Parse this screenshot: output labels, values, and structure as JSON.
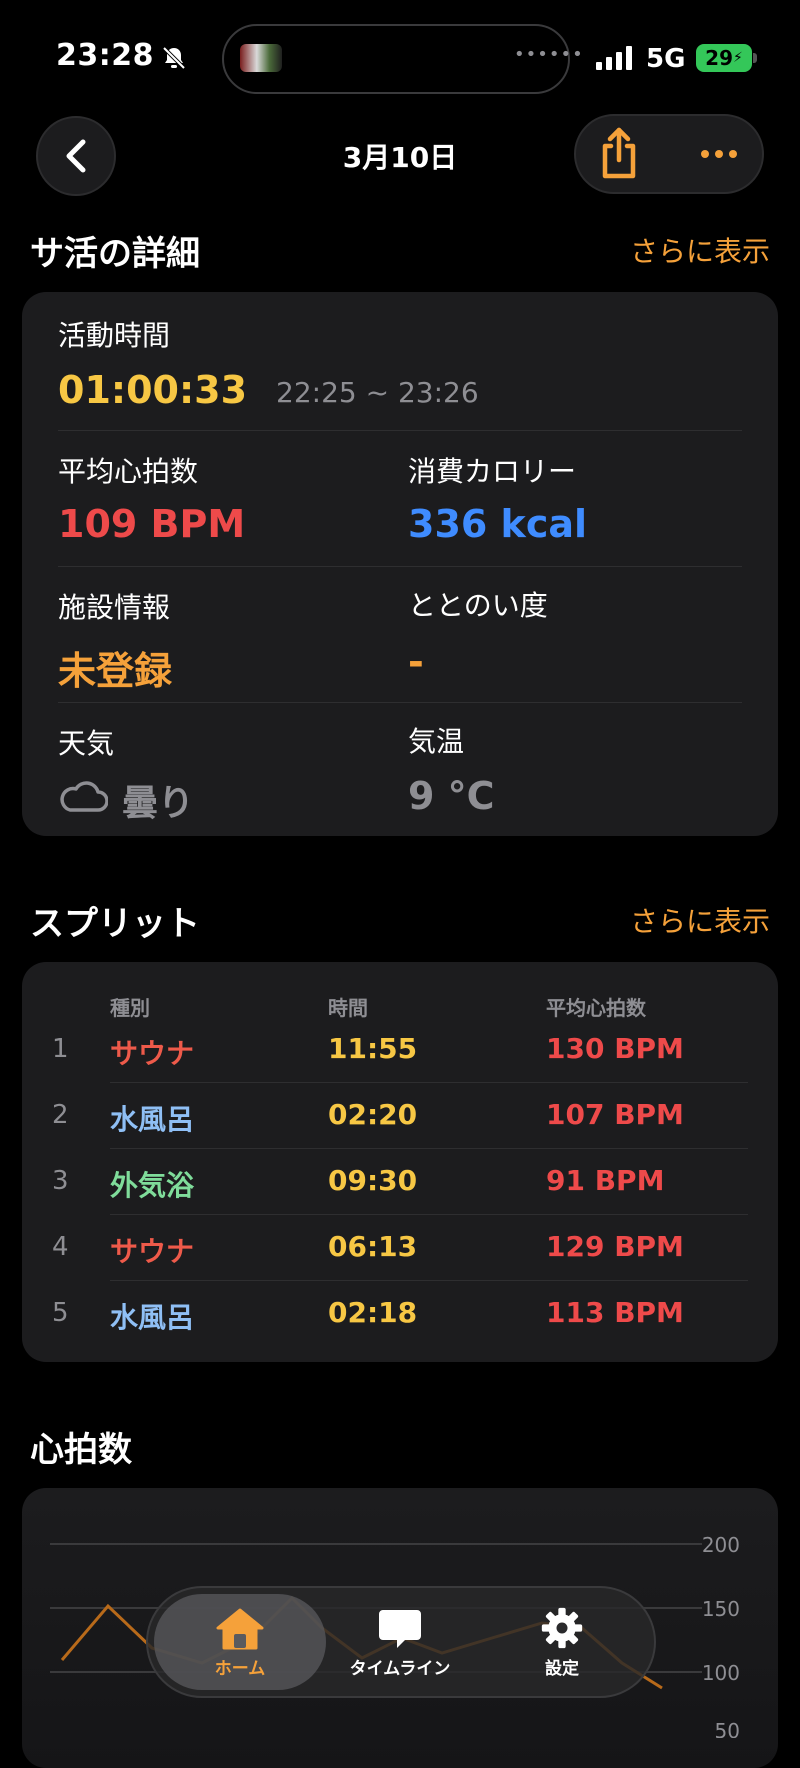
{
  "status_bar": {
    "time": "23:28",
    "network": "5G",
    "battery": "29"
  },
  "nav": {
    "title": "3月10日"
  },
  "summary": {
    "section_title": "サ活の詳細",
    "see_more": "さらに表示",
    "activity_time_label": "活動時間",
    "activity_time_value": "01:00:33",
    "activity_time_range": "22:25 ~ 23:26",
    "avg_hr_label": "平均心拍数",
    "avg_hr_value": "109 BPM",
    "calories_label": "消費カロリー",
    "calories_value": "336 kcal",
    "facility_label": "施設情報",
    "facility_value": "未登録",
    "totonoi_label": "ととのい度",
    "totonoi_value": "-",
    "weather_label": "天気",
    "weather_value": "曇り",
    "temp_label": "気温",
    "temp_value": "9 °C"
  },
  "splits": {
    "section_title": "スプリット",
    "see_more": "さらに表示",
    "headers": [
      "種別",
      "時間",
      "平均心拍数"
    ],
    "rows": [
      {
        "no": "1",
        "type": "サウナ",
        "type_color": "#ee5a4a",
        "time": "11:55",
        "hr": "130 BPM"
      },
      {
        "no": "2",
        "type": "水風呂",
        "type_color": "#8fbff5",
        "time": "02:20",
        "hr": "107 BPM"
      },
      {
        "no": "3",
        "type": "外気浴",
        "type_color": "#7fdc9a",
        "time": "09:30",
        "hr": "91 BPM"
      },
      {
        "no": "4",
        "type": "サウナ",
        "type_color": "#ee5a4a",
        "time": "06:13",
        "hr": "129 BPM"
      },
      {
        "no": "5",
        "type": "水風呂",
        "type_color": "#8fbff5",
        "time": "02:18",
        "hr": "113 BPM"
      }
    ]
  },
  "heart_rate": {
    "section_title": "心拍数",
    "axis_ticks": [
      "200",
      "150",
      "100",
      "50"
    ]
  },
  "tabbar": {
    "home": "ホーム",
    "timeline": "タイムライン",
    "settings": "設定"
  }
}
